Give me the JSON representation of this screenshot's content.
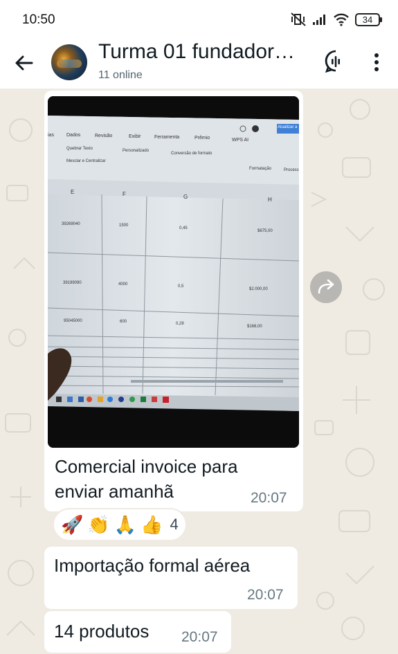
{
  "status_bar": {
    "time": "10:50",
    "battery": "34"
  },
  "header": {
    "title": "Turma 01 fundador…",
    "subtitle": "11 online"
  },
  "messages": [
    {
      "type": "image",
      "photo": {
        "ribbon_tabs": [
          "ias",
          "Dados",
          "Revisão",
          "Exibir",
          "Ferramenta",
          "Prêmio",
          "WPS AI"
        ],
        "update_button": "Atualizar a",
        "wrap_text": "Quebrar Texto",
        "merge_center": "Mesclar e Centralizar",
        "number_format": "Personalizado",
        "convert_format": "Conversão de formato",
        "formatting": "Formatação",
        "process": "Process",
        "columns": [
          "E",
          "F",
          "G",
          "H"
        ],
        "rows": [
          [
            "39269040",
            "1500",
            "0,45",
            "$675,00"
          ],
          [
            "39199090",
            "4000",
            "0,5",
            "$2.000,00"
          ],
          [
            "95045000",
            "600",
            "0,28",
            "$168,00"
          ]
        ]
      },
      "caption": [
        "Comercial invoice para",
        "enviar amanhã"
      ],
      "time": "20:07",
      "reactions": {
        "emojis": [
          "🚀",
          "👏",
          "🙏",
          "👍"
        ],
        "count": "4"
      }
    },
    {
      "type": "text",
      "text": "Importação formal aérea",
      "time": "20:07"
    },
    {
      "type": "text",
      "text": "14 produtos",
      "time": "20:07"
    }
  ]
}
